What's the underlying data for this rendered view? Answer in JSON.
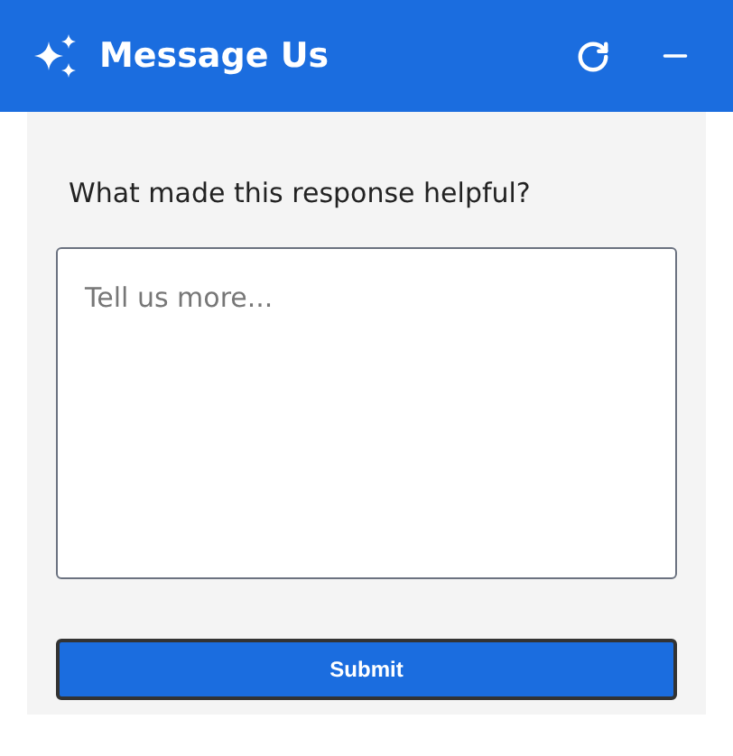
{
  "header": {
    "title": "Message Us"
  },
  "form": {
    "question": "What made this response helpful?",
    "placeholder": "Tell us more...",
    "submit": "Submit"
  }
}
